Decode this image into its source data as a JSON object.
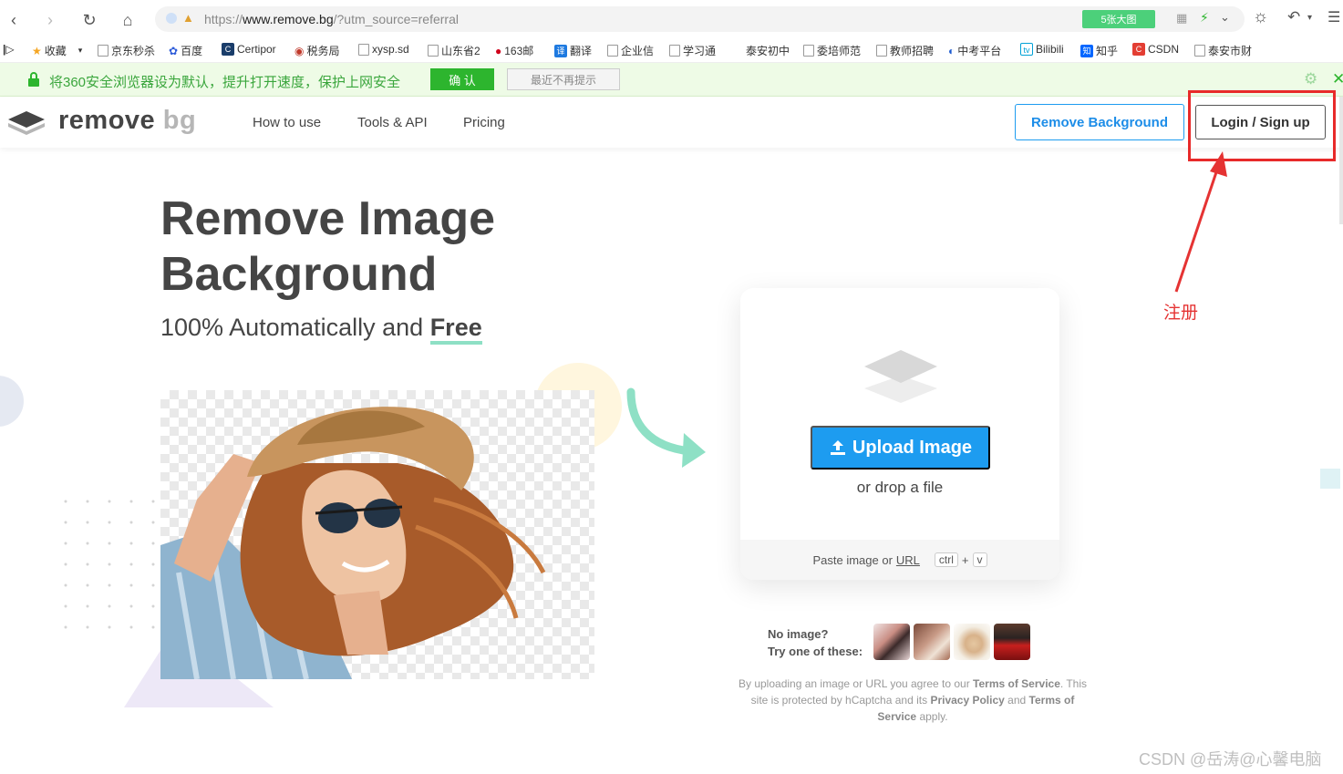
{
  "browser": {
    "url_prefix": "https://",
    "url_domain": "www.remove.bg",
    "url_path": "/?utm_source=referral",
    "image_badge": "5张大图",
    "bookmarks": [
      "收藏",
      "京东秒杀",
      "百度",
      "Certipor",
      "税务局",
      "xysp.sd",
      "山东省2",
      "163邮",
      "翻译",
      "企业信",
      "学习通",
      "泰安初中",
      "委培师范",
      "教师招聘",
      "中考平台",
      "Bilibili",
      "知乎",
      "CSDN",
      "泰安市财"
    ],
    "notice": {
      "text": "将360安全浏览器设为默认，提升打开速度，保护上网安全",
      "confirm": "确 认",
      "dismiss": "最近不再提示"
    }
  },
  "site": {
    "logo_remove": "remove",
    "logo_bg": "bg",
    "nav": [
      "How to use",
      "Tools & API",
      "Pricing"
    ],
    "remove_bg_button": "Remove Background",
    "login_button": "Login / Sign up"
  },
  "hero": {
    "title": "Remove Image Background",
    "subtitle_prefix": "100% Automatically and ",
    "subtitle_free": "Free"
  },
  "upload": {
    "button": "Upload Image",
    "drop_text": "or drop a file",
    "paste_prefix": "Paste image or ",
    "paste_url": "URL",
    "key_ctrl": "ctrl",
    "key_plus": "+",
    "key_v": "v"
  },
  "samples": {
    "line1": "No image?",
    "line2": "Try one of these:"
  },
  "legal": {
    "part1": "By uploading an image or URL you agree to our ",
    "terms": "Terms of Service",
    "part2": ". This site is protected by hCaptcha and its ",
    "privacy": "Privacy Policy",
    "and": " and ",
    "terms2": "Terms of Service",
    "apply": " apply."
  },
  "annotation": {
    "label": "注册",
    "color": "#e53333"
  },
  "watermark": "CSDN @岳涛@心馨电脑",
  "colors": {
    "accent_blue": "#1d9cf0",
    "notice_green": "#2db52e",
    "underline_mint": "#8ee0c5"
  }
}
